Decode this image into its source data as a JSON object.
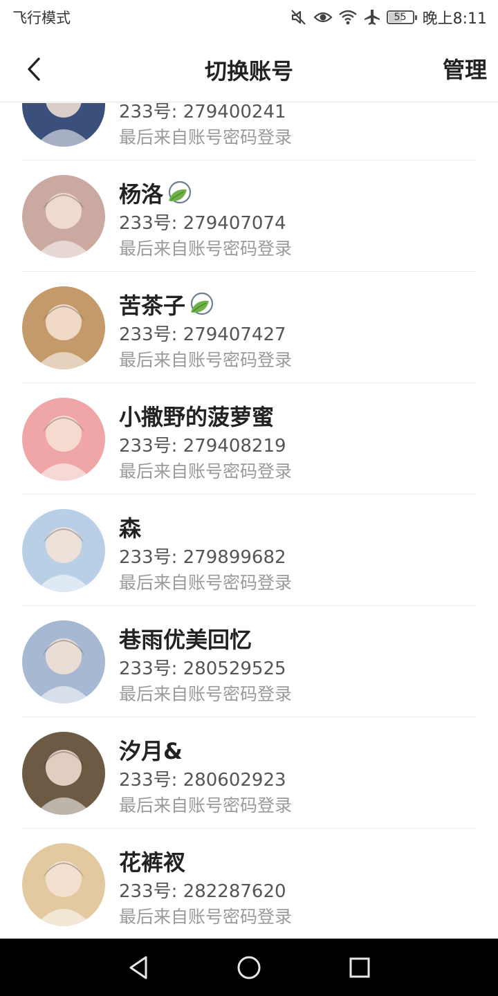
{
  "status_bar": {
    "mode_label": "飞行模式",
    "battery": "55",
    "battery_level": 0.55,
    "time": "晚上8:11",
    "icons": [
      "mute-icon",
      "eye-icon",
      "wifi-icon",
      "airplane-icon",
      "battery-icon"
    ]
  },
  "nav": {
    "title": "切换账号",
    "manage_label": "管理",
    "back_icon": "chevron-left-icon"
  },
  "accounts": [
    {
      "name": "",
      "id_text": "233号: 279400241",
      "login_text": "最后来自账号密码登录",
      "badge": false,
      "avatar_color": "#3a4f7a"
    },
    {
      "name": "杨洛",
      "id_text": "233号: 279407074",
      "login_text": "最后来自账号密码登录",
      "badge": true,
      "avatar_color": "#c9a9a0"
    },
    {
      "name": "苦茶子",
      "id_text": "233号: 279407427",
      "login_text": "最后来自账号密码登录",
      "badge": true,
      "avatar_color": "#c59a6a"
    },
    {
      "name": "小撒野的菠萝蜜",
      "id_text": "233号: 279408219",
      "login_text": "最后来自账号密码登录",
      "badge": false,
      "avatar_color": "#f0a6a6"
    },
    {
      "name": "森",
      "id_text": "233号: 279899682",
      "login_text": "最后来自账号密码登录",
      "badge": false,
      "avatar_color": "#b9cfe6"
    },
    {
      "name": "巷雨优美回忆",
      "id_text": "233号: 280529525",
      "login_text": "最后来自账号密码登录",
      "badge": false,
      "avatar_color": "#a7b9d2"
    },
    {
      "name": "汐月&",
      "id_text": "233号: 280602923",
      "login_text": "最后来自账号密码登录",
      "badge": false,
      "avatar_color": "#6d5a44"
    },
    {
      "name": "花裤衩",
      "id_text": "233号: 282287620",
      "login_text": "最后来自账号密码登录",
      "badge": false,
      "avatar_color": "#e2c9a0"
    }
  ],
  "system_nav": {
    "back": "triangle-back-icon",
    "home": "circle-home-icon",
    "recents": "square-recents-icon"
  }
}
